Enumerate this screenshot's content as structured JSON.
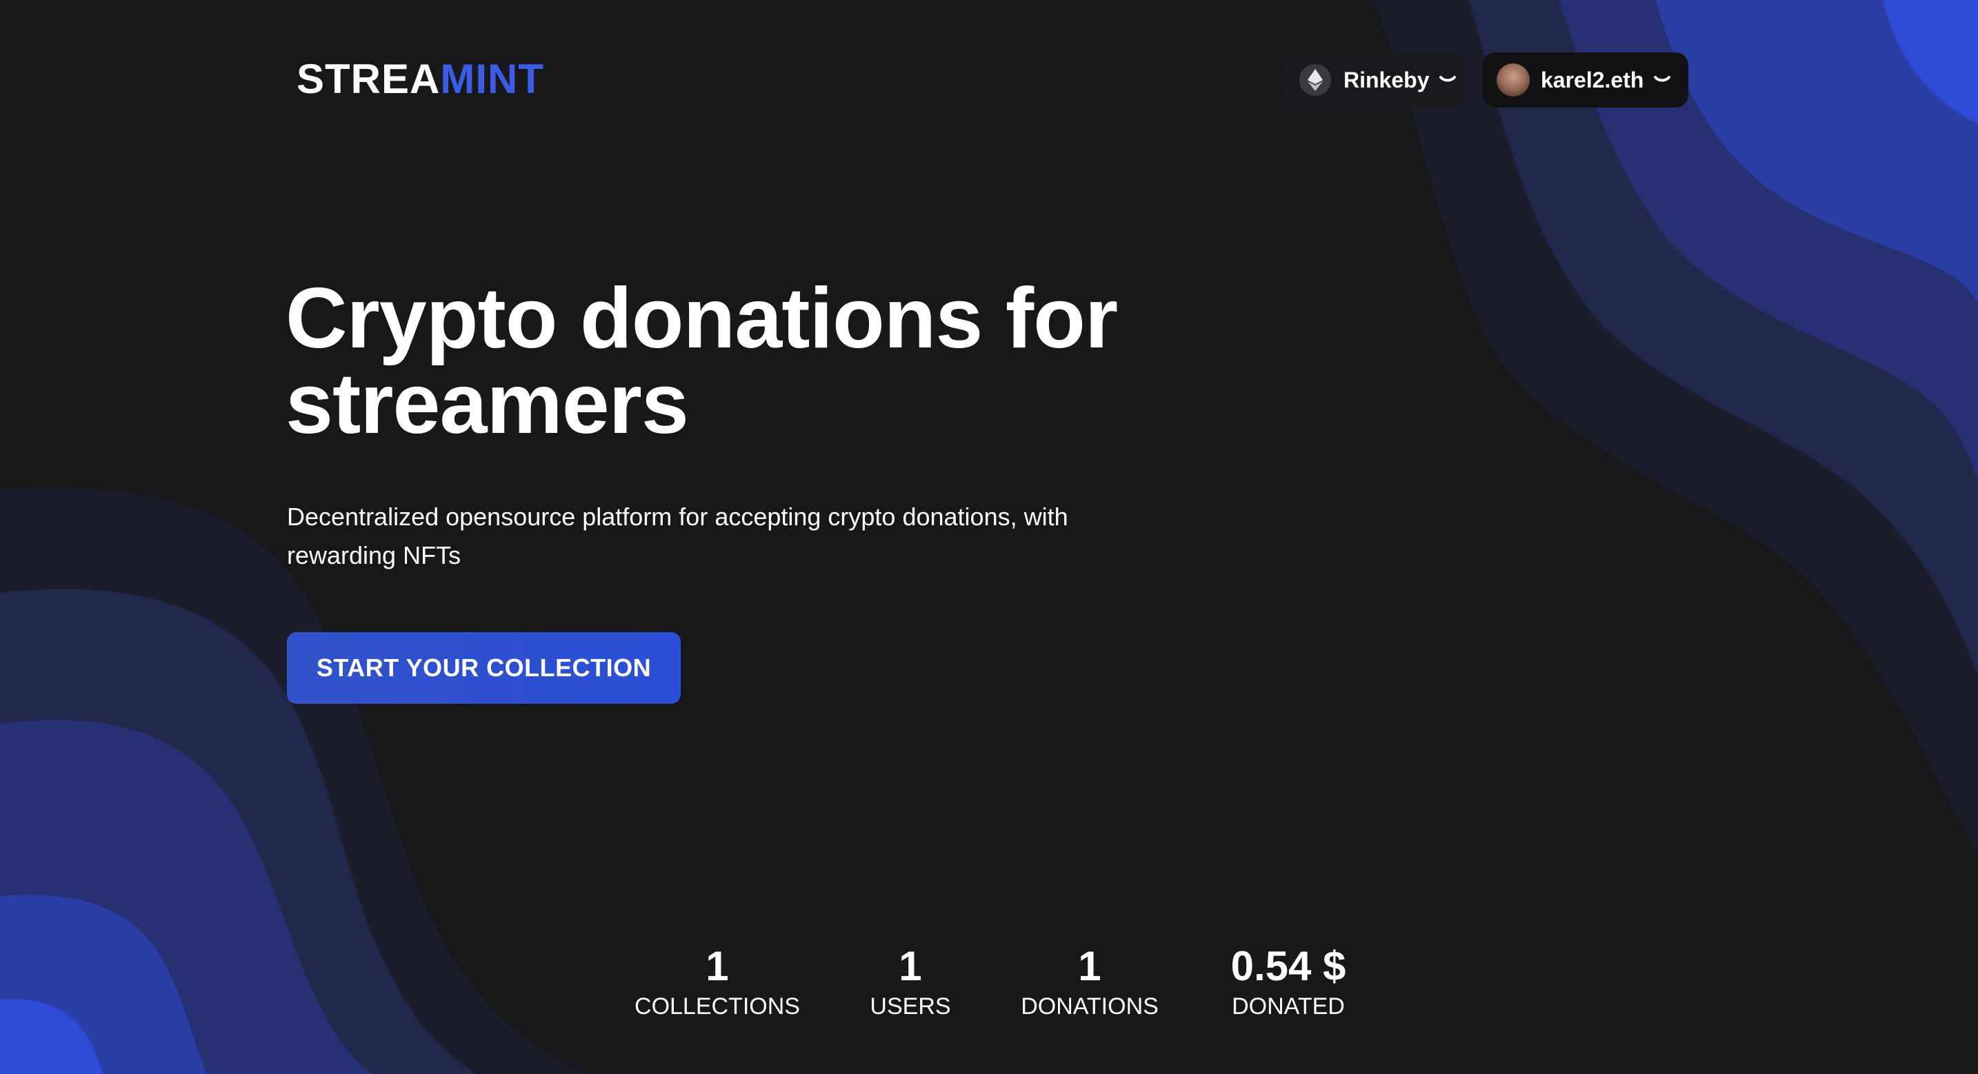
{
  "header": {
    "logo_part1": "STREA",
    "logo_part2": "MINT",
    "network": {
      "label": "Rinkeby",
      "icon": "ethereum-icon"
    },
    "account": {
      "label": "karel2.eth",
      "icon": "avatar"
    }
  },
  "hero": {
    "title": "Crypto donations for streamers",
    "subtitle": "Decentralized opensource platform for accepting crypto donations, with rewarding NFTs",
    "cta_label": "START YOUR COLLECTION"
  },
  "stats": [
    {
      "value": "1",
      "label": "COLLECTIONS"
    },
    {
      "value": "1",
      "label": "USERS"
    },
    {
      "value": "1",
      "label": "DONATIONS"
    },
    {
      "value": "0.54 $",
      "label": "DONATED"
    }
  ],
  "colors": {
    "background": "#18181b",
    "accent": "#3b5ce6",
    "button": "#2b4fd6"
  }
}
